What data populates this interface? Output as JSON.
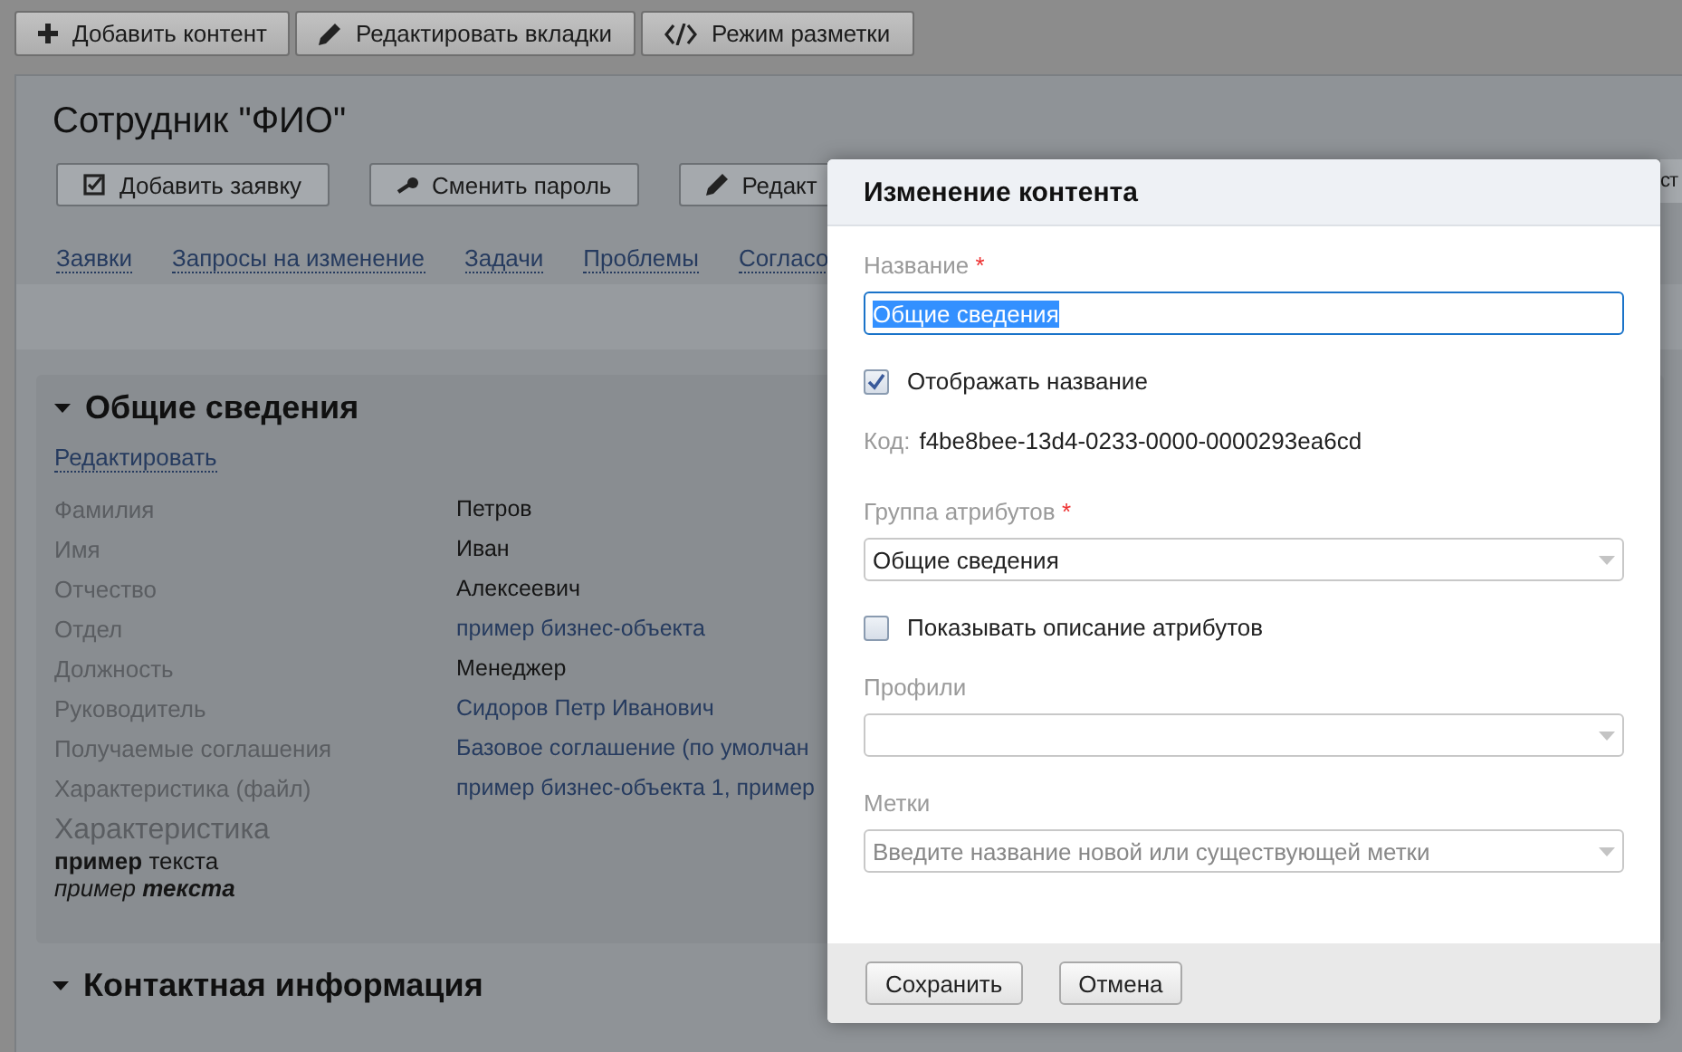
{
  "toolbar": [
    {
      "label": "Добавить контент"
    },
    {
      "label": "Редактировать вкладки"
    },
    {
      "label": "Режим разметки"
    }
  ],
  "page": {
    "title": "Сотрудник \"ФИО\"",
    "actions": [
      {
        "label": "Добавить заявку"
      },
      {
        "label": "Сменить пароль"
      },
      {
        "label": "Редакт"
      }
    ],
    "edge_action": {
      "label": "ст"
    },
    "tabs": [
      {
        "label": "Заявки"
      },
      {
        "label": "Запросы на изменение"
      },
      {
        "label": "Задачи"
      },
      {
        "label": "Проблемы"
      },
      {
        "label": "Согласо"
      }
    ],
    "sections": [
      {
        "title": "Общие сведения",
        "expanded": true,
        "edit_link": "Редактировать",
        "rows": [
          {
            "label": "Фамилия",
            "value": "Петров",
            "kind": "text"
          },
          {
            "label": "Имя",
            "value": "Иван",
            "kind": "text"
          },
          {
            "label": "Отчество",
            "value": "Алексеевич",
            "kind": "text"
          },
          {
            "label": "Отдел",
            "value": "пример бизнес-объекта",
            "kind": "link"
          },
          {
            "label": "Должность",
            "value": "Менеджер",
            "kind": "text"
          },
          {
            "label": "Руководитель",
            "value": "Сидоров Петр Иванович",
            "kind": "link"
          },
          {
            "label": "Получаемые соглашения",
            "value": "Базовое соглашение (по умолчан",
            "kind": "link"
          },
          {
            "label": "Характеристика (файл)",
            "value": "пример бизнес-объекта 1, пример",
            "kind": "link"
          }
        ],
        "rich_field": {
          "label": "Характеристика",
          "lines": [
            {
              "text": "**пример** текста",
              "italic": false
            },
            {
              "text": "пример **текста**",
              "italic": true
            }
          ]
        }
      },
      {
        "title": "Контактная информация",
        "expanded": true
      }
    ]
  },
  "dialog": {
    "title": "Изменение контента",
    "fields": [
      {
        "kind": "text",
        "label": "Название",
        "required_mark": "*",
        "value": "Общие сведения",
        "text_selected": true
      },
      {
        "kind": "checkbox",
        "label": "Отображать название",
        "checked": true
      },
      {
        "kind": "info",
        "label": "Код:",
        "value": "f4be8bee-13d4-0233-0000-0000293ea6cd"
      },
      {
        "kind": "select",
        "label": "Группа атрибутов",
        "required_mark": "*",
        "value": "Общие сведения"
      },
      {
        "kind": "checkbox",
        "label": "Показывать описание атрибутов",
        "checked": false
      },
      {
        "kind": "select",
        "label": "Профили"
      },
      {
        "kind": "select",
        "label": "Метки",
        "placeholder": "Введите название новой или существующей метки"
      }
    ],
    "buttons": [
      {
        "label": "Сохранить"
      },
      {
        "label": "Отмена"
      }
    ]
  }
}
